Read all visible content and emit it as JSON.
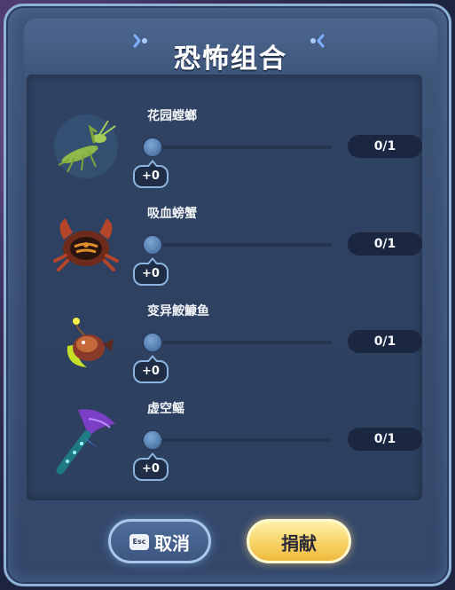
{
  "dialog": {
    "title": "恐怖组合"
  },
  "items": [
    {
      "name": "花园螳螂",
      "icon": "mantis-icon",
      "progress": 0,
      "bonus": "+0",
      "count": "0/1"
    },
    {
      "name": "吸血螃蟹",
      "icon": "crab-icon",
      "progress": 0,
      "bonus": "+0",
      "count": "0/1"
    },
    {
      "name": "变异鮟鱇鱼",
      "icon": "anglerfish-icon",
      "progress": 0,
      "bonus": "+0",
      "count": "0/1"
    },
    {
      "name": "虚空鳐",
      "icon": "void-ray-icon",
      "progress": 0,
      "bonus": "+0",
      "count": "0/1"
    }
  ],
  "buttons": {
    "cancel_key": "Esc",
    "cancel_label": "取消",
    "donate_label": "捐献"
  },
  "colors": {
    "panel": "#3a4f72",
    "accent_slider": "#58c9ff",
    "donate_button": "#f7d366"
  }
}
